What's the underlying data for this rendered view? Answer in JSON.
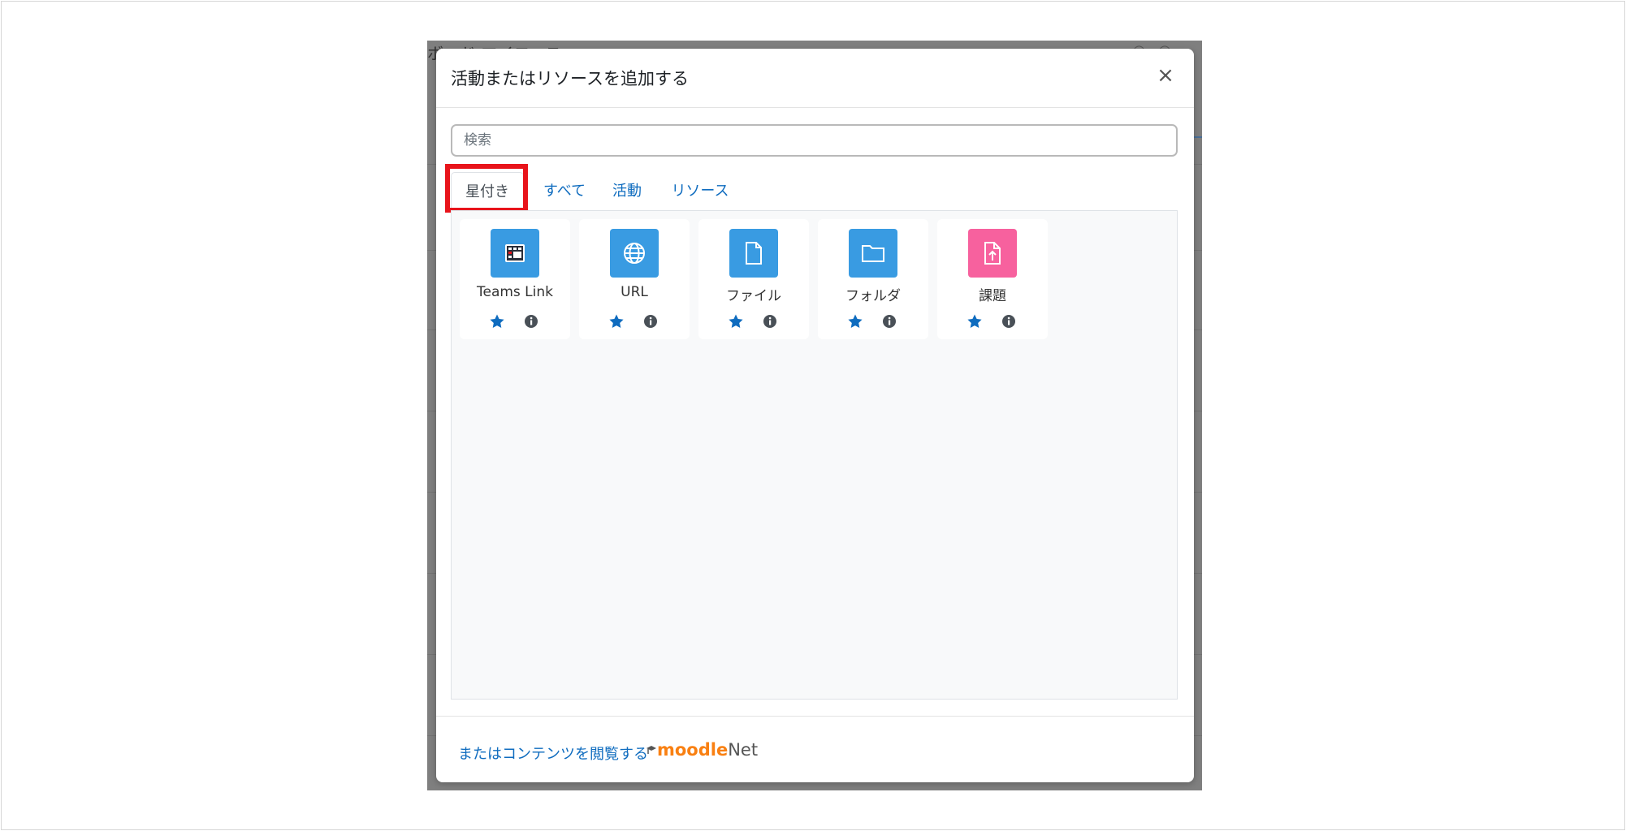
{
  "background": {
    "partial_text": "ボード マイコース"
  },
  "modal": {
    "title": "活動またはリソースを追加する",
    "close_label": "×",
    "search_placeholder": "検索",
    "tabs": [
      {
        "label": "星付き",
        "active": true
      },
      {
        "label": "すべて",
        "active": false
      },
      {
        "label": "活動",
        "active": false
      },
      {
        "label": "リソース",
        "active": false
      }
    ],
    "items": [
      {
        "label": "Teams Link",
        "icon": "teams-link-icon",
        "color": "#399be2",
        "starred": true
      },
      {
        "label": "URL",
        "icon": "globe-icon",
        "color": "#399be2",
        "starred": true
      },
      {
        "label": "ファイル",
        "icon": "file-icon",
        "color": "#399be2",
        "starred": true
      },
      {
        "label": "フォルダ",
        "icon": "folder-icon",
        "color": "#399be2",
        "starred": true
      },
      {
        "label": "課題",
        "icon": "assignment-upload-icon",
        "color": "#f7619e",
        "starred": true
      }
    ],
    "footer": {
      "link_text": "またはコンテンツを閲覧する",
      "brand_moodle": "moodle",
      "brand_net": "Net"
    }
  },
  "colors": {
    "link": "#0f6cbf",
    "highlight_box": "#e8141b",
    "star": "#0f6cbf"
  }
}
